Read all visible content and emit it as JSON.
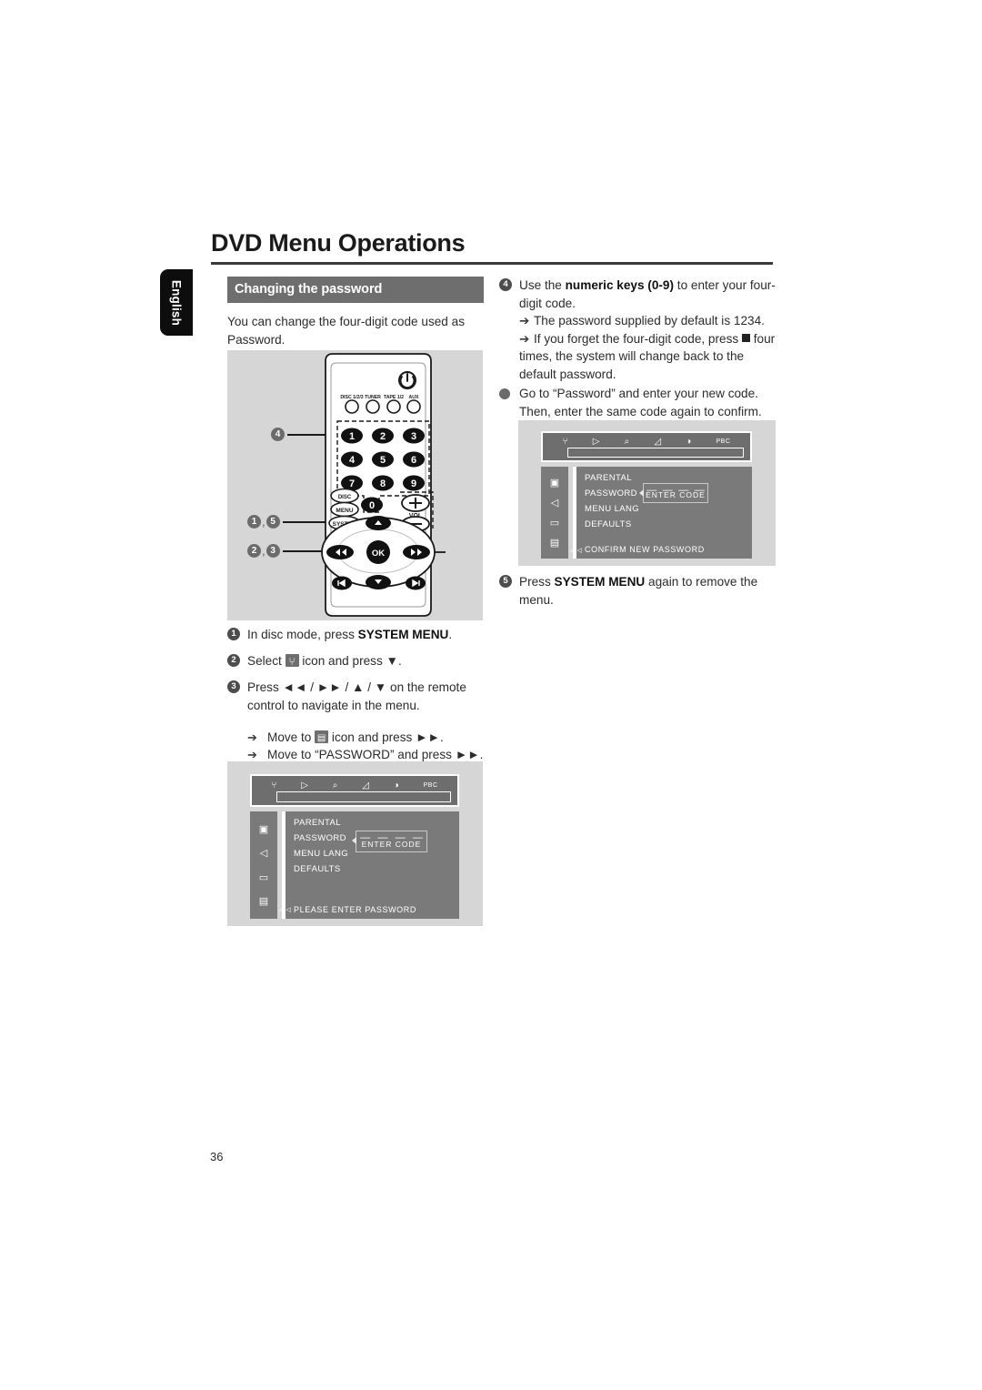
{
  "page": {
    "title": "DVD Menu Operations",
    "language_tab": "English",
    "page_number": "36"
  },
  "left_column": {
    "section_heading": "Changing the password",
    "intro": "You can change the four-digit code used as Password.",
    "steps": [
      {
        "num": "1",
        "text_before": "In disc mode, press ",
        "bold": "SYSTEM MENU",
        "text_after": "."
      },
      {
        "num": "2",
        "text_before": "Select ",
        "icon": "tools-icon",
        "text_after": " icon and press ▼."
      },
      {
        "num": "3",
        "text_before": "Press ◄◄ / ►► / ▲ / ▼ on the remote control to navigate in the menu.",
        "bold": "",
        "text_after": ""
      }
    ],
    "sub_steps": [
      {
        "arrow": "➔",
        "text_before": "Move to ",
        "icon": "tv-icon",
        "text_after": " icon and press ►►."
      },
      {
        "arrow": "➔",
        "text_before": "Move to “PASSWORD” and press ►►.",
        "icon": "",
        "text_after": ""
      }
    ]
  },
  "right_column": {
    "steps": [
      {
        "num": "4",
        "lines": [
          {
            "type": "plain",
            "before": "Use the ",
            "bold": "numeric keys (0-9)",
            "after": " to enter your four-digit code."
          },
          {
            "type": "arrow",
            "arrow": "➔",
            "before": "The password supplied by default is 1234.",
            "bold": "",
            "after": ""
          },
          {
            "type": "arrow",
            "arrow": "➔",
            "before": "If you forget the four-digit code, press ",
            "bold": "■",
            "after": " four times, the system will change back to the default password."
          }
        ]
      },
      {
        "num": "●",
        "lines": [
          {
            "type": "plain",
            "before": "Go to “Password” and enter your new code. Then, enter the same code again to confirm.",
            "bold": "",
            "after": ""
          }
        ]
      },
      {
        "num": "5",
        "lines": [
          {
            "type": "plain",
            "before": "Press ",
            "bold": "SYSTEM MENU",
            "after": " again to remove the menu."
          }
        ]
      }
    ]
  },
  "remote_figure": {
    "power_button": "power-icon",
    "source_buttons": [
      "DISC 1/2/3",
      "TUNER",
      "TAPE 1/2",
      "AUX"
    ],
    "numeric_keys": [
      "1",
      "2",
      "3",
      "4",
      "5",
      "6",
      "7",
      "8",
      "9",
      "0"
    ],
    "left_stack": [
      "DISC",
      "MENU",
      "SYSTEM"
    ],
    "volume_label": "VOL",
    "volume_plus": "+",
    "volume_minus": "−",
    "ok_button": "OK",
    "nav_up": "▲",
    "nav_down": "▼",
    "nav_rew": "◄◄",
    "nav_ff": "►►",
    "prev_track": "▮◄",
    "next_track": "►▮",
    "callouts": [
      {
        "id": "callout-4",
        "labels": [
          "4"
        ]
      },
      {
        "id": "callout-1-5",
        "labels": [
          "1",
          "5"
        ]
      },
      {
        "id": "callout-2-3",
        "labels": [
          "2",
          "3"
        ]
      }
    ]
  },
  "osd_bottom": {
    "top_bar_icons": [
      "tools-icon",
      "play-icon",
      "zoom-icon",
      "audio-icon",
      "brightness-icon",
      "PBC"
    ],
    "sidebar_icons": [
      "id-card-icon",
      "speaker-icon",
      "subtitle-icon",
      "tv-icon"
    ],
    "menu_items": [
      "PARENTAL",
      "PASSWORD",
      "MENU LANG",
      "DEFAULTS"
    ],
    "highlighted_item": "PASSWORD",
    "code_dashes": [
      "—",
      "—",
      "—",
      "—"
    ],
    "code_label": "ENTER CODE",
    "status": "PLEASE ENTER PASSWORD"
  },
  "osd_top": {
    "top_bar_icons": [
      "tools-icon",
      "play-icon",
      "zoom-icon",
      "audio-icon",
      "brightness-icon",
      "PBC"
    ],
    "sidebar_icons": [
      "id-card-icon",
      "speaker-icon",
      "subtitle-icon",
      "tv-icon"
    ],
    "menu_items": [
      "PARENTAL",
      "PASSWORD",
      "MENU LANG",
      "DEFAULTS"
    ],
    "highlighted_item": "PASSWORD",
    "code_dashes": [
      "—",
      "—",
      "—",
      "—"
    ],
    "code_label": "ENTER CODE",
    "status": "CONFIRM NEW PASSWORD"
  }
}
